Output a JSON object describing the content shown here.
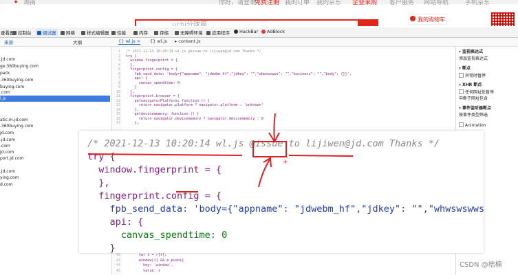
{
  "site": {
    "top_links": [
      "湖南",
      "你好，请登录",
      "免费注册",
      "我的订单",
      "我的京东",
      "企业采购",
      "客户服务",
      "网站导航",
      "手机京东"
    ],
    "search_placeholder": "uchi分球膜",
    "cart_label": "我的购物车"
  },
  "toolbar": {
    "items": [
      {
        "label": "查看器",
        "icon": "inspector-icon"
      },
      {
        "label": "控制台",
        "icon": "console-icon"
      },
      {
        "label": "调试器",
        "icon": "debugger-icon",
        "active": true
      },
      {
        "label": "网络",
        "icon": "network-icon"
      },
      {
        "label": "样式编辑器",
        "icon": "style-editor-icon"
      },
      {
        "label": "性能",
        "icon": "performance-icon"
      },
      {
        "label": "内存",
        "icon": "memory-icon"
      },
      {
        "label": "存储",
        "icon": "storage-icon"
      },
      {
        "label": "无障碍环境",
        "icon": "accessibility-icon"
      },
      {
        "label": "应用程序",
        "icon": "application-icon"
      },
      {
        "label": "HackBar",
        "icon": "hackbar-icon"
      },
      {
        "label": "AdBlock",
        "icon": "adblock-icon"
      }
    ]
  },
  "subbar": {
    "sources_label": "来源",
    "outline_label": "大纲",
    "tabs": [
      "wl.js",
      "wl.js",
      "content.js"
    ]
  },
  "sources": [
    ".jd.com",
    "ge.360buying.com",
    "pack",
    ".360buying.com",
    "buying.com",
    ".com",
    "l.js",
    "",
    "",
    "atic.m.jd.com",
    ".360buying.com",
    "jd.com",
    ".jd.com",
    ".com",
    "jd.com",
    "port.jd.com",
    ".jd.com",
    "ying.com",
    "d.com"
  ],
  "code": {
    "line_numbers": [
      "1",
      "2",
      "3",
      "4",
      "5",
      "6",
      "7",
      "8",
      "9",
      "10",
      "11",
      "12",
      "13",
      "14",
      "15",
      "16",
      "17",
      "18",
      "19",
      "20"
    ],
    "lines": [
      "/* 2021-12-13 10:20:14 wl.js @issue to lijiwen@jd.com Thanks */",
      "try {",
      "  window.fingerprint = {",
      "  },",
      "  fingerprint.config = {",
      "    fpb_send_data: 'body={\"appname\": \"jdwebm_hf\",\"jdkey\": \"\",\"whwswswws\": \"\",\"business\": \"\",\"body\": {}}',",
      "    api: {",
      "      canvas_spendtime: 0",
      "    }",
      "  },",
      "  fingerprint.browser = {",
      "    getnavigatorPlatform: function () {",
      "      return navigator.platform ? navigator.platform : 'unknown'",
      "    },",
      "    getdevicememory: function () {",
      "      return navigator.devicememory ? navigator.devicememory : 0",
      "    },"
    ],
    "bottom_line_numbers": [
      "42",
      "43",
      "44",
      "45",
      "46"
    ],
    "bottom_lines": [
      "      var i = r[t];",
      "      window[i] && e.push({",
      "        key: 'window',",
      "        value: i"
    ]
  },
  "zoom": {
    "lines": [
      "/* 2021-12-13 10:20:14 wl.js @issue to lijiwen@jd.com Thanks */",
      "try {",
      "  window.fingerprint = {",
      "  },",
      "  fingerprint.config = {",
      "    fpb_send_data: 'body={\"appname\": \"jdwebm_hf\",\"jdkey\": \"\",\"whwswswws\": \"\",\"business\": \"",
      "    api: {",
      "      canvas_spendtime: 0",
      "    }",
      "  },",
      "  fingerprint.browser = {"
    ]
  },
  "right_panel": {
    "items": [
      {
        "label": "监视表达式",
        "type": "head"
      },
      {
        "label": "添加监视表达式",
        "type": "plain"
      },
      {
        "label": "断点",
        "type": "head"
      },
      {
        "label": "异常时暂停",
        "type": "check"
      },
      {
        "label": "XHR 断点",
        "type": "head"
      },
      {
        "label": "任何网址处暂停",
        "type": "check"
      },
      {
        "label": "中断于网址包含",
        "type": "plain"
      },
      {
        "label": "事件监听器断点",
        "type": "head"
      },
      {
        "label": "按事件类型筛选",
        "type": "plain"
      },
      {
        "label": "Animation",
        "type": "check"
      },
      {
        "label": "d",
        "type": "plain"
      },
      {
        "label": "ulation",
        "type": "plain"
      },
      {
        "label": "d Drop",
        "type": "plain"
      },
      {
        "label": "rd",
        "type": "plain"
      },
      {
        "label": "ket",
        "type": "plain"
      },
      {
        "label": "ation 断点",
        "type": "head"
      },
      {
        "label": "断点 中的",
        "type": "plain"
      }
    ]
  },
  "watermark": "CSDN @桔楠",
  "colors": {
    "annotation": "#e02020",
    "accent": "#1a5fb4",
    "brand": "#e1251b"
  }
}
